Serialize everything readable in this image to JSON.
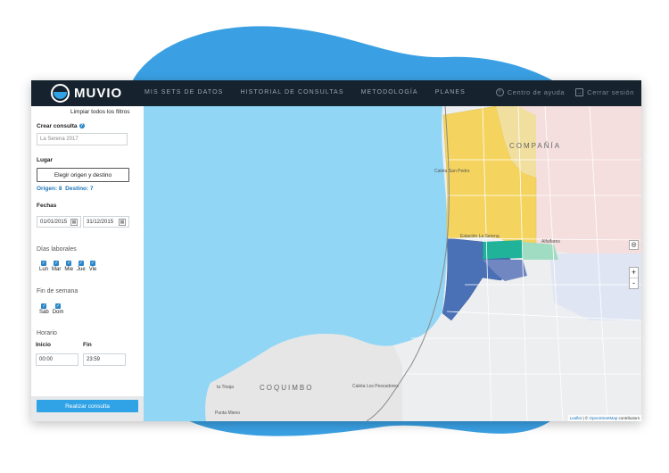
{
  "brand": {
    "name": "MUVIO"
  },
  "nav": {
    "items": [
      "MIS SETS DE DATOS",
      "HISTORIAL DE CONSULTAS",
      "METODOLOGÍA",
      "PLANES"
    ],
    "help": "Centro de ayuda",
    "logout": "Cerrar sesión"
  },
  "sidebar": {
    "clear_filters": "Limpiar todos los filtros",
    "create_title": "Crear consulta",
    "query_name_placeholder": "La Serena 2017",
    "place_title": "Lugar",
    "choose_button": "Elegir origen y destino",
    "origin": "Origen: 8",
    "destination": "Destino: 7",
    "dates_title": "Fechas",
    "date_from": "01/01/2015",
    "date_to": "31/12/2015",
    "weekdays_title": "Días laborales",
    "weekdays": [
      "Lun",
      "Mar",
      "Mie",
      "Jue",
      "Vie"
    ],
    "weekend_title": "Fin de semana",
    "weekend": [
      "Sáb",
      "Dom"
    ],
    "schedule_title": "Horario",
    "start_label": "Inicio",
    "end_label": "Fin",
    "start_value": "00:00",
    "end_value": "23:59",
    "submit": "Realizar consulta"
  },
  "map": {
    "labels": {
      "compania": "COMPAÑÍA",
      "coquimbo": "COQUIMBO",
      "caleta_san_pedro": "Caleta San Pedro",
      "estacion": "Estación La Serena",
      "la_serena": "La Serena",
      "alfalfares": "Alfalfares",
      "tierras_blancas": "ta Tinaja",
      "punta_mira": "Punta Mieno",
      "caleta_pescadores": "Caleta Los Pescadores"
    },
    "zoom_in": "+",
    "zoom_out": "-",
    "attribution_leaflet": "Leaflet",
    "attribution_osm": "OpenStreetMap",
    "attribution_rest": "contributors",
    "colors": {
      "sea": "#92d6f5",
      "origin_yellow": "#f4d35e",
      "dest_blue": "#4a70b6",
      "teal": "#20b39a",
      "zone_pink": "#f5dede",
      "zone_blue": "#dfe5f3"
    }
  }
}
